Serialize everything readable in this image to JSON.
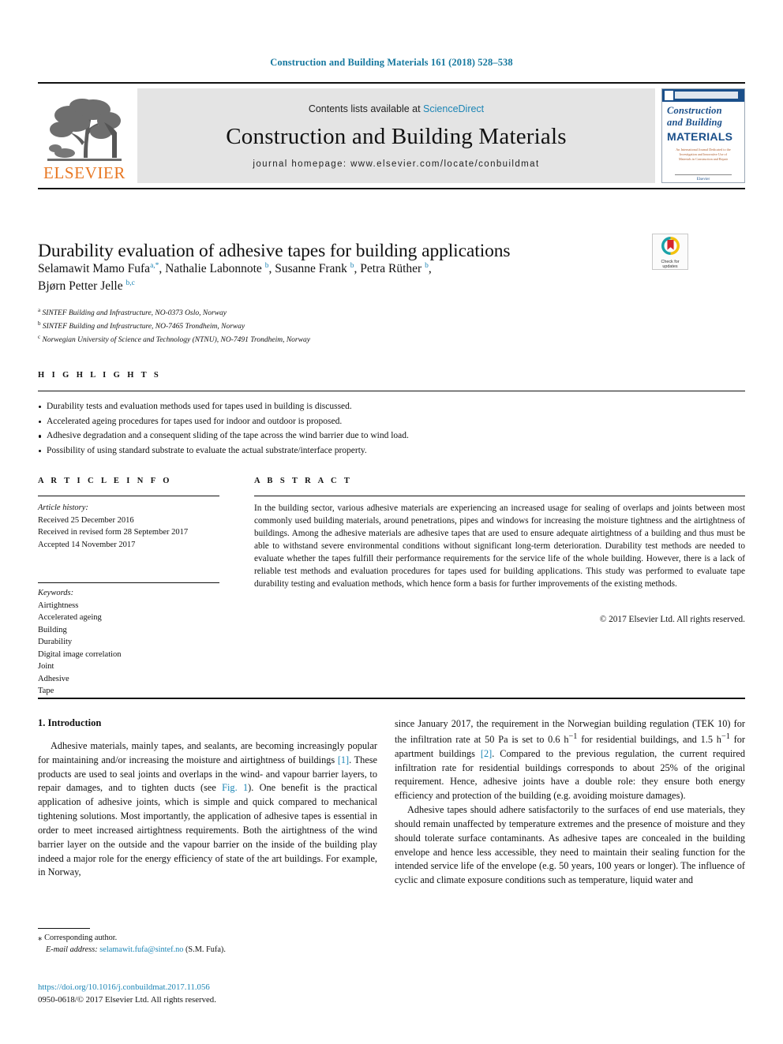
{
  "running_head": "Construction and Building Materials 161 (2018) 528–538",
  "masthead": {
    "publisher_logo_alt": "elsevier-tree-logo",
    "publisher_name": "ELSEVIER",
    "contents_prefix": "Contents lists available at ",
    "contents_link": "ScienceDirect",
    "journal_title": "Construction and Building Materials",
    "homepage": "journal homepage: www.elsevier.com/locate/conbuildmat",
    "cover": {
      "line1": "Construction",
      "line2": "and Building",
      "line3": "MATERIALS",
      "blurb": "An International Journal Dedicated to the Investigation and Innovative Use of Materials in Construction and Repair",
      "footer": "Elsevier"
    }
  },
  "article": {
    "title": "Durability evaluation of adhesive tapes for building applications",
    "authors": [
      {
        "name": "Selamawit Mamo Fufa",
        "marks": "a,*",
        "sep": ", "
      },
      {
        "name": "Nathalie Labonnote",
        "marks": "b",
        "sep": ", "
      },
      {
        "name": "Susanne Frank",
        "marks": "b",
        "sep": ", "
      },
      {
        "name": "Petra Rüther",
        "marks": "b",
        "sep": ", "
      },
      {
        "name": "Bjørn Petter Jelle",
        "marks": "b,c",
        "sep": ""
      }
    ],
    "affiliations": [
      {
        "mark": "a",
        "text": "SINTEF Building and Infrastructure, NO-0373 Oslo, Norway"
      },
      {
        "mark": "b",
        "text": "SINTEF Building and Infrastructure, NO-7465 Trondheim, Norway"
      },
      {
        "mark": "c",
        "text": "Norwegian University of Science and Technology (NTNU), NO-7491 Trondheim, Norway"
      }
    ]
  },
  "crossmark": {
    "line1": "Check for",
    "line2": "updates",
    "icon": "crossmark-badge-icon"
  },
  "highlights": {
    "heading": "H I G H L I G H T S",
    "items": [
      "Durability tests and evaluation methods used for tapes used in building is discussed.",
      "Accelerated ageing procedures for tapes used for indoor and outdoor is proposed.",
      "Adhesive degradation and a consequent sliding of the tape across the wind barrier due to wind load.",
      "Possibility of using standard substrate to evaluate the actual substrate/interface property."
    ]
  },
  "article_info": {
    "heading": "A R T I C L E   I N F O",
    "history_label": "Article history:",
    "history": [
      "Received 25 December 2016",
      "Received in revised form 28 September 2017",
      "Accepted 14 November 2017"
    ],
    "keywords_label": "Keywords:",
    "keywords": [
      "Airtightness",
      "Accelerated ageing",
      "Building",
      "Durability",
      "Digital image correlation",
      "Joint",
      "Adhesive",
      "Tape"
    ]
  },
  "abstract": {
    "heading": "A B S T R A C T",
    "text": "In the building sector, various adhesive materials are experiencing an increased usage for sealing of overlaps and joints between most commonly used building materials, around penetrations, pipes and windows for increasing the moisture tightness and the airtightness of buildings. Among the adhesive materials are adhesive tapes that are used to ensure adequate airtightness of a building and thus must be able to withstand severe environmental conditions without significant long-term deterioration. Durability test methods are needed to evaluate whether the tapes fulfill their performance requirements for the service life of the whole building. However, there is a lack of reliable test methods and evaluation procedures for tapes used for building applications. This study was performed to evaluate tape durability testing and evaluation methods, which hence form a basis for further improvements of the existing methods.",
    "copyright": "© 2017 Elsevier Ltd. All rights reserved."
  },
  "body": {
    "section_heading": "1. Introduction",
    "left_para_1_a": "Adhesive materials, mainly tapes, and sealants, are becoming increasingly popular for maintaining and/or increasing the moisture and airtightness of buildings ",
    "left_ref_1": "[1]",
    "left_para_1_b": ". These products are used to seal joints and overlaps in the wind- and vapour barrier layers, to repair damages, and to tighten ducts (see ",
    "left_fig_ref": "Fig. 1",
    "left_para_1_c": "). One benefit is the practical application of adhesive joints, which is simple and quick compared to mechanical tightening solutions. Most importantly, the application of adhesive tapes is essential in order to meet increased airtightness requirements. Both the airtightness of the wind barrier layer on the outside and the vapour barrier on the inside of the building play indeed a major role for the energy efficiency of state of the art buildings. For example, in Norway,",
    "right_para_1_a": "since January 2017, the requirement in the Norwegian building regulation (TEK 10) for the infiltration rate at 50 Pa is set to 0.6 h",
    "right_sup_1": "−1",
    "right_para_1_b": " for residential buildings, and 1.5 h",
    "right_sup_2": "−1",
    "right_para_1_c": " for apartment buildings ",
    "right_ref_2": "[2]",
    "right_para_1_d": ". Compared to the previous regulation, the current required infiltration rate for residential buildings corresponds to about 25% of the original requirement. Hence, adhesive joints have a double role: they ensure both energy efficiency and protection of the building (e.g. avoiding moisture damages).",
    "right_para_2": "Adhesive tapes should adhere satisfactorily to the surfaces of end use materials, they should remain unaffected by temperature extremes and the presence of moisture and they should tolerate surface contaminants. As adhesive tapes are concealed in the building envelope and hence less accessible, they need to maintain their sealing function for the intended service life of the envelope (e.g. 50 years, 100 years or longer). The influence of cyclic and climate exposure conditions such as temperature, liquid water and"
  },
  "footnotes": {
    "corresponding_mark": "⁎",
    "corresponding_text": "Corresponding author.",
    "email_label": "E-mail address:",
    "email": "selamawit.fufa@sintef.no",
    "email_suffix": " (S.M. Fufa).",
    "doi": "https://doi.org/10.1016/j.conbuildmat.2017.11.056",
    "issn_line": "0950-0618/© 2017 Elsevier Ltd. All rights reserved."
  },
  "colors": {
    "link": "#1c85b5",
    "elsevier_orange": "#e87722",
    "running_head": "#16789f",
    "band_gray": "#e4e4e4"
  }
}
